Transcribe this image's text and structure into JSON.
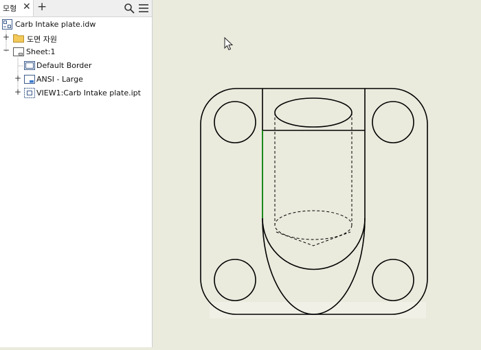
{
  "panel": {
    "tab_label": "모형",
    "close_glyph": "✕",
    "add_glyph": "+"
  },
  "tree": {
    "root": {
      "label": "Carb Intake plate.idw",
      "icon": "drawing-document-icon"
    },
    "items": [
      {
        "label": "도면 자원",
        "icon": "folder-icon",
        "expander": "+"
      },
      {
        "label": "Sheet:1",
        "icon": "sheet-icon",
        "expander": "−"
      },
      {
        "label": "Default Border",
        "icon": "border-icon"
      },
      {
        "label": "ANSI - Large",
        "icon": "title-block-icon",
        "expander": "+"
      },
      {
        "label": "VIEW1:Carb Intake plate.ipt",
        "icon": "drawing-view-icon",
        "expander": "+"
      }
    ]
  },
  "colors": {
    "canvas_bg": "#eaeadd",
    "line": "#000000",
    "highlight_edge": "#1a8a1a"
  }
}
